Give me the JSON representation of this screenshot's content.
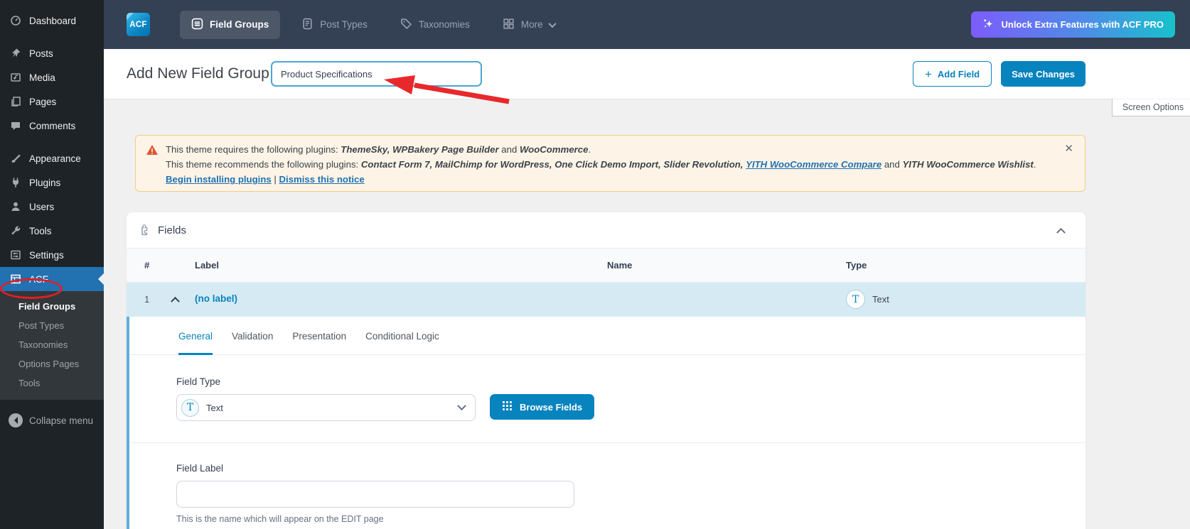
{
  "colors": {
    "acf_blue": "#0783be",
    "topbar": "#344054",
    "wp_active_blue": "#2271b1",
    "row_highlight": "#d6eaf4",
    "notice_bg": "#fdf4e7",
    "notice_border": "#f2cd86",
    "annotation_red": "#de2026",
    "pro_gradient_start": "#7c5cfa",
    "pro_gradient_end": "#18c1cb"
  },
  "icons": {
    "close": "✕",
    "plus": "+"
  },
  "sidebar": {
    "items": [
      {
        "label": "Dashboard"
      },
      {
        "label": "Posts"
      },
      {
        "label": "Media"
      },
      {
        "label": "Pages"
      },
      {
        "label": "Comments"
      },
      {
        "label": "Appearance"
      },
      {
        "label": "Plugins"
      },
      {
        "label": "Users"
      },
      {
        "label": "Tools"
      },
      {
        "label": "Settings"
      },
      {
        "label": "ACF"
      }
    ],
    "submenu": [
      "Field Groups",
      "Post Types",
      "Taxonomies",
      "Options Pages",
      "Tools"
    ],
    "collapse_label": "Collapse menu"
  },
  "topbar": {
    "logo_text": "ACF",
    "tabs": [
      {
        "label": "Field Groups"
      },
      {
        "label": "Post Types"
      },
      {
        "label": "Taxonomies"
      },
      {
        "label": "More"
      }
    ],
    "pro_button": "Unlock Extra Features with ACF PRO"
  },
  "header": {
    "title": "Add New Field Group",
    "title_input_value": "Product Specifications",
    "add_field_button": "Add Field",
    "save_button": "Save Changes",
    "screen_options": "Screen Options"
  },
  "notice": {
    "line1": [
      "This theme requires the following plugins: ",
      "ThemeSky, WPBakery Page Builder",
      " and ",
      "WooCommerce",
      "."
    ],
    "line2": [
      "This theme recommends the following plugins: ",
      "Contact Form 7, MailChimp for WordPress, One Click Demo Import, Slider Revolution,",
      " ",
      "YITH WooCommerce Compare",
      " and ",
      "YITH WooCommerce Wishlist",
      "."
    ],
    "links": {
      "install": "Begin installing plugins",
      "separator": "|",
      "dismiss": "Dismiss this notice"
    }
  },
  "fields_panel": {
    "title": "Fields",
    "columns": {
      "num": "#",
      "label": "Label",
      "name": "Name",
      "type": "Type"
    },
    "row": {
      "num": "1",
      "label": "(no label)",
      "name": "",
      "type_label": "Text",
      "type_icon_letter": "T"
    },
    "tabs": [
      {
        "label": "General"
      },
      {
        "label": "Validation"
      },
      {
        "label": "Presentation"
      },
      {
        "label": "Conditional Logic"
      }
    ],
    "field_type": {
      "label": "Field Type",
      "value": "Text",
      "icon_letter": "T",
      "browse_button": "Browse Fields"
    },
    "field_label": {
      "label": "Field Label",
      "value": "",
      "help": "This is the name which will appear on the EDIT page"
    }
  }
}
